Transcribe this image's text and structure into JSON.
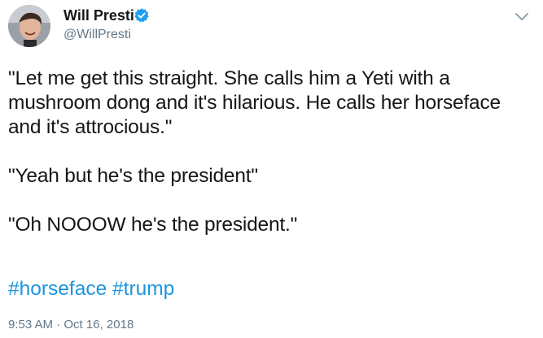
{
  "author": {
    "name": "Will Presti",
    "handle": "@WillPresti",
    "verified_icon": "verified-badge-icon",
    "avatar_icon": "avatar"
  },
  "tweet": {
    "paragraphs": [
      "\"Let me get this straight. She calls him a Yeti with a mushroom dong and it's hilarious. He calls her horseface and it's attrocious.\"",
      "\"Yeah but he's the president\"",
      "\"Oh NOOOW he's the president.\""
    ],
    "hashtags": [
      "#horseface",
      "#trump"
    ],
    "time": "9:53 AM",
    "separator": "·",
    "date": "Oct 16, 2018"
  },
  "colors": {
    "link": "#1b95e0",
    "muted": "#657786",
    "text": "#14171a",
    "verified": "#1da1f2"
  },
  "menu_icon": "chevron-down-icon"
}
